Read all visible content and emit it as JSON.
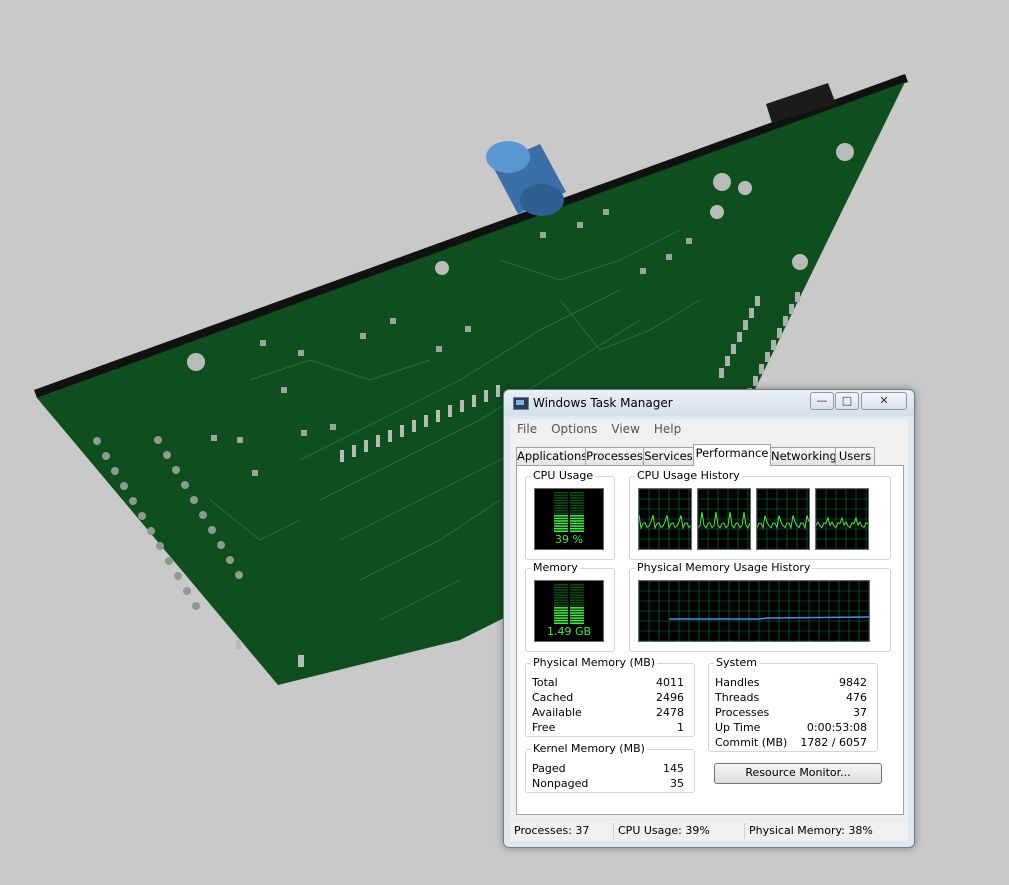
{
  "window": {
    "title": "Windows Task Manager",
    "controls": {
      "minimize": "—",
      "maximize": "□",
      "close": "✕"
    }
  },
  "menu": [
    "File",
    "Options",
    "View",
    "Help"
  ],
  "tabs": [
    "Applications",
    "Processes",
    "Services",
    "Performance",
    "Networking",
    "Users"
  ],
  "active_tab": "Performance",
  "performance": {
    "cpu_usage": {
      "label": "CPU Usage",
      "value": "39 %",
      "level": 0.39
    },
    "cpu_history": {
      "label": "CPU Usage History",
      "cores": 4
    },
    "memory": {
      "label": "Memory",
      "value": "1.49 GB",
      "level": 0.38
    },
    "memory_history": {
      "label": "Physical Memory Usage History"
    },
    "physical_memory": {
      "label": "Physical Memory (MB)",
      "rows": [
        {
          "key": "Total",
          "value": "4011"
        },
        {
          "key": "Cached",
          "value": "2496"
        },
        {
          "key": "Available",
          "value": "2478"
        },
        {
          "key": "Free",
          "value": "1"
        }
      ]
    },
    "kernel_memory": {
      "label": "Kernel Memory (MB)",
      "rows": [
        {
          "key": "Paged",
          "value": "145"
        },
        {
          "key": "Nonpaged",
          "value": "35"
        }
      ]
    },
    "system": {
      "label": "System",
      "rows": [
        {
          "key": "Handles",
          "value": "9842"
        },
        {
          "key": "Threads",
          "value": "476"
        },
        {
          "key": "Processes",
          "value": "37"
        },
        {
          "key": "Up Time",
          "value": "0:00:53:08"
        },
        {
          "key": "Commit (MB)",
          "value": "1782 / 6057"
        }
      ]
    },
    "resource_monitor_button": "Resource Monitor..."
  },
  "status": {
    "processes": "Processes: 37",
    "cpu": "CPU Usage: 39%",
    "memory": "Physical Memory: 38%"
  },
  "colors": {
    "pcb_green": "#0f4f1f",
    "meter_green": "#3cf03c",
    "graph_grid": "#0b7a3a",
    "memory_line": "#4a8cf0",
    "capacitor_blue": "#4a86c4",
    "background": "#c9c9c9"
  }
}
